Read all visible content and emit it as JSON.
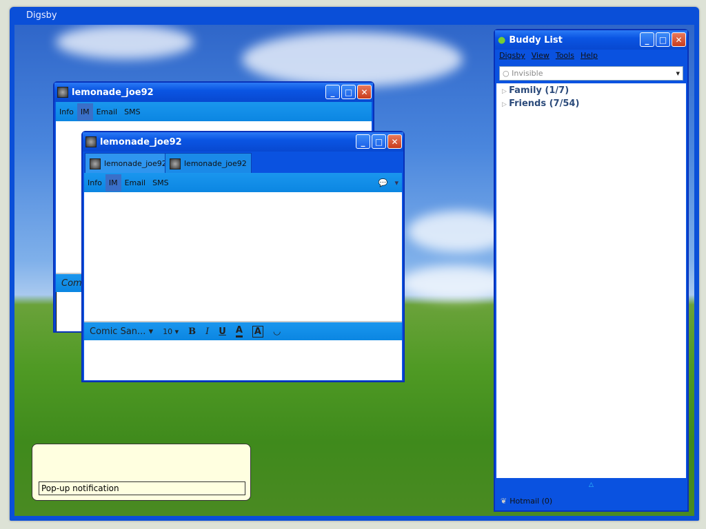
{
  "app_title": "Digsby",
  "chat_back": {
    "title": "lemonade_joe92",
    "menu": [
      "Info",
      "IM",
      "Email",
      "SMS"
    ],
    "font": "Comic San"
  },
  "chat_front": {
    "title": "lemonade_joe92",
    "tabs": [
      "lemonade_joe92",
      "lemonade_joe92"
    ],
    "menu": [
      "Info",
      "IM",
      "Email",
      "SMS"
    ],
    "font": "Comic San...",
    "size": "10",
    "format": [
      "B",
      "I",
      "U",
      "A",
      "A"
    ]
  },
  "buddy_list": {
    "title": "Buddy List",
    "menu": [
      "Digsby",
      "View",
      "Tools",
      "Help"
    ],
    "status": "Invisible",
    "groups": [
      "Family (1/7)",
      "Friends (7/54)"
    ],
    "footer": "Hotmail (0)"
  },
  "popup": {
    "text": "Pop-up notification"
  },
  "colors": {
    "titlebar": "#0a55e3",
    "toolbar": "#0b86e2",
    "popup": "#ffffe0"
  }
}
